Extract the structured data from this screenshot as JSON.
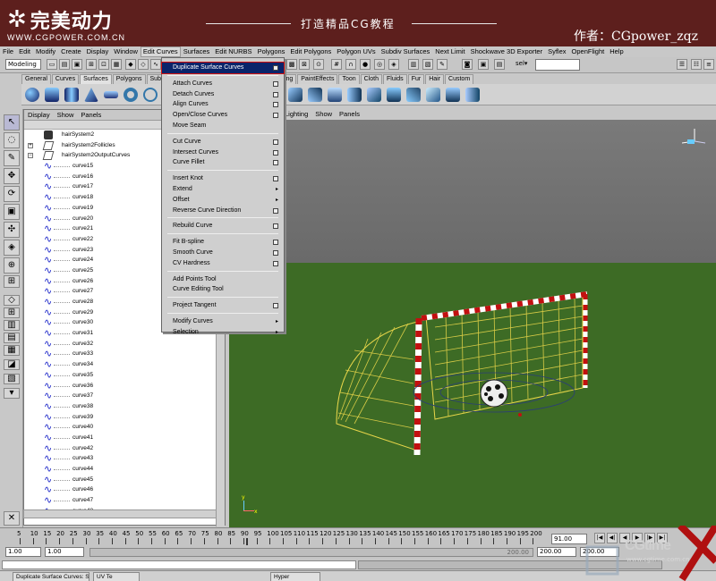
{
  "banner": {
    "logo_text": "完美动力",
    "site": "WWW.CGPOWER.COM.CN",
    "tagline": "打造精品CG教程",
    "author": "作者：CGpower_zqz"
  },
  "menubar": {
    "items": [
      "File",
      "Edit",
      "Modify",
      "Create",
      "Display",
      "Window",
      "Edit Curves",
      "Surfaces",
      "Edit NURBS",
      "Polygons",
      "Edit Polygons",
      "Polygon UVs",
      "Subdiv Surfaces",
      "Next Limit",
      "Shockwave 3D Exporter",
      "Syflex",
      "OpenFlight",
      "Help"
    ],
    "active_index": 6
  },
  "statusline": {
    "mode": "Modeling",
    "sel_label": "sel▾"
  },
  "shelf": {
    "tabs": [
      "General",
      "Curves",
      "Surfaces",
      "Polygons",
      "Subdiv"
    ],
    "active_tab": "Surfaces",
    "tabs_right": [
      "hing",
      "PaintEffects",
      "Toon",
      "Cloth",
      "Fluids",
      "Fur",
      "Hair",
      "Custom"
    ]
  },
  "outliner": {
    "menu": [
      "Display",
      "Show",
      "Panels"
    ],
    "items": [
      {
        "label": "hairSystem2",
        "kind": "hair",
        "expand": ""
      },
      {
        "label": "hairSystem2Follicles",
        "kind": "group",
        "expand": "+"
      },
      {
        "label": "hairSystem2OutputCurves",
        "kind": "group",
        "expand": "−"
      },
      {
        "label": "curve15",
        "kind": "curve"
      },
      {
        "label": "curve16",
        "kind": "curve"
      },
      {
        "label": "curve17",
        "kind": "curve"
      },
      {
        "label": "curve18",
        "kind": "curve"
      },
      {
        "label": "curve19",
        "kind": "curve"
      },
      {
        "label": "curve20",
        "kind": "curve"
      },
      {
        "label": "curve21",
        "kind": "curve"
      },
      {
        "label": "curve22",
        "kind": "curve"
      },
      {
        "label": "curve23",
        "kind": "curve"
      },
      {
        "label": "curve24",
        "kind": "curve"
      },
      {
        "label": "curve25",
        "kind": "curve"
      },
      {
        "label": "curve26",
        "kind": "curve"
      },
      {
        "label": "curve27",
        "kind": "curve"
      },
      {
        "label": "curve28",
        "kind": "curve"
      },
      {
        "label": "curve29",
        "kind": "curve"
      },
      {
        "label": "curve30",
        "kind": "curve"
      },
      {
        "label": "curve31",
        "kind": "curve"
      },
      {
        "label": "curve32",
        "kind": "curve"
      },
      {
        "label": "curve33",
        "kind": "curve"
      },
      {
        "label": "curve34",
        "kind": "curve"
      },
      {
        "label": "curve35",
        "kind": "curve"
      },
      {
        "label": "curve36",
        "kind": "curve"
      },
      {
        "label": "curve37",
        "kind": "curve"
      },
      {
        "label": "curve38",
        "kind": "curve"
      },
      {
        "label": "curve39",
        "kind": "curve"
      },
      {
        "label": "curve40",
        "kind": "curve"
      },
      {
        "label": "curve41",
        "kind": "curve"
      },
      {
        "label": "curve42",
        "kind": "curve"
      },
      {
        "label": "curve43",
        "kind": "curve"
      },
      {
        "label": "curve44",
        "kind": "curve"
      },
      {
        "label": "curve45",
        "kind": "curve"
      },
      {
        "label": "curve46",
        "kind": "curve"
      },
      {
        "label": "curve47",
        "kind": "curve"
      },
      {
        "label": "curve48",
        "kind": "curve"
      }
    ]
  },
  "viewport": {
    "menu": [
      "Lighting",
      "Show",
      "Panels"
    ],
    "axis_y": "y",
    "axis_x": "x",
    "colors": {
      "sky": "#727272",
      "ground": "#3d6b25",
      "post_red": "#c21010",
      "net_yellow": "#e8d64a"
    }
  },
  "edit_curves_menu": {
    "items": [
      {
        "label": "Duplicate Surface Curves",
        "box": true,
        "highlight": true
      },
      {
        "sep": true
      },
      {
        "label": "Attach Curves",
        "box": true
      },
      {
        "label": "Detach Curves",
        "box": true
      },
      {
        "label": "Align Curves",
        "box": true
      },
      {
        "label": "Open/Close Curves",
        "box": true
      },
      {
        "label": "Move Seam"
      },
      {
        "sep": true
      },
      {
        "label": "Cut Curve",
        "box": true
      },
      {
        "label": "Intersect Curves",
        "box": true
      },
      {
        "label": "Curve Fillet",
        "box": true
      },
      {
        "sep": true
      },
      {
        "label": "Insert Knot",
        "box": true
      },
      {
        "label": "Extend",
        "arrow": true
      },
      {
        "label": "Offset",
        "arrow": true
      },
      {
        "label": "Reverse Curve Direction",
        "box": true
      },
      {
        "sep": true
      },
      {
        "label": "Rebuild Curve",
        "box": true
      },
      {
        "sep": true
      },
      {
        "label": "Fit B-spline",
        "box": true
      },
      {
        "label": "Smooth Curve",
        "box": true
      },
      {
        "label": "CV Hardness",
        "box": true
      },
      {
        "sep": true
      },
      {
        "label": "Add Points Tool"
      },
      {
        "label": "Curve Editing Tool"
      },
      {
        "sep": true
      },
      {
        "label": "Project Tangent",
        "box": true
      },
      {
        "sep": true
      },
      {
        "label": "Modify Curves",
        "arrow": true
      },
      {
        "label": "Selection",
        "arrow": true
      }
    ]
  },
  "timeslider": {
    "ticks": [
      "5",
      "10",
      "15",
      "20",
      "25",
      "30",
      "35",
      "40",
      "45",
      "50",
      "55",
      "60",
      "65",
      "70",
      "75",
      "80",
      "85",
      "90",
      "95",
      "100",
      "105",
      "110",
      "115",
      "120",
      "125",
      "130",
      "135",
      "140",
      "145",
      "150",
      "155",
      "160",
      "165",
      "170",
      "175",
      "180",
      "185",
      "190",
      "195",
      "200"
    ],
    "current_frame": "91.00"
  },
  "rangebar": {
    "start": "1.00",
    "playback_start": "1.00",
    "playback_end": "200.00",
    "end": "200.00",
    "range_label": "200.00"
  },
  "helpline": {
    "tasks": [
      "Duplicate Surface Curves: S",
      "UV Te",
      "Hyper"
    ]
  },
  "watermark": {
    "brand": "CGtime",
    "site": "www.cgtime.com.cn"
  }
}
